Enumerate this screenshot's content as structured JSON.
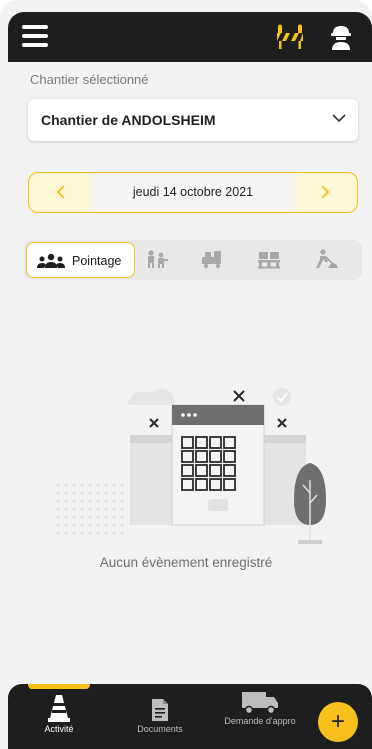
{
  "header": {
    "menu_icon": "hamburger-menu-icon",
    "barrier_icon": "road-barrier-icon",
    "profile_icon": "worker-helmet-icon"
  },
  "site_selector": {
    "label": "Chantier sélectionné",
    "value": "Chantier de ANDOLSHEIM"
  },
  "date_nav": {
    "date": "jeudi 14 octobre 2021",
    "prev_icon": "chevron-left-icon",
    "next_icon": "chevron-right-icon"
  },
  "tabs": {
    "active_label": "Pointage",
    "items": [
      "people-icon",
      "workers-icon",
      "truck-loading-icon",
      "pallet-icon",
      "worker-digging-icon"
    ]
  },
  "empty_state": {
    "message": "Aucun évènement enregistré"
  },
  "bottom_nav": {
    "items": [
      {
        "label": "Activité",
        "icon": "traffic-cone-icon"
      },
      {
        "label": "Documents",
        "icon": "document-icon"
      },
      {
        "label": "Demande d'appro",
        "icon": "delivery-truck-icon"
      }
    ],
    "fab_label": "+"
  },
  "colors": {
    "accent": "#f6c11a",
    "dark": "#1e1e1e",
    "background": "#f3f3f3"
  }
}
